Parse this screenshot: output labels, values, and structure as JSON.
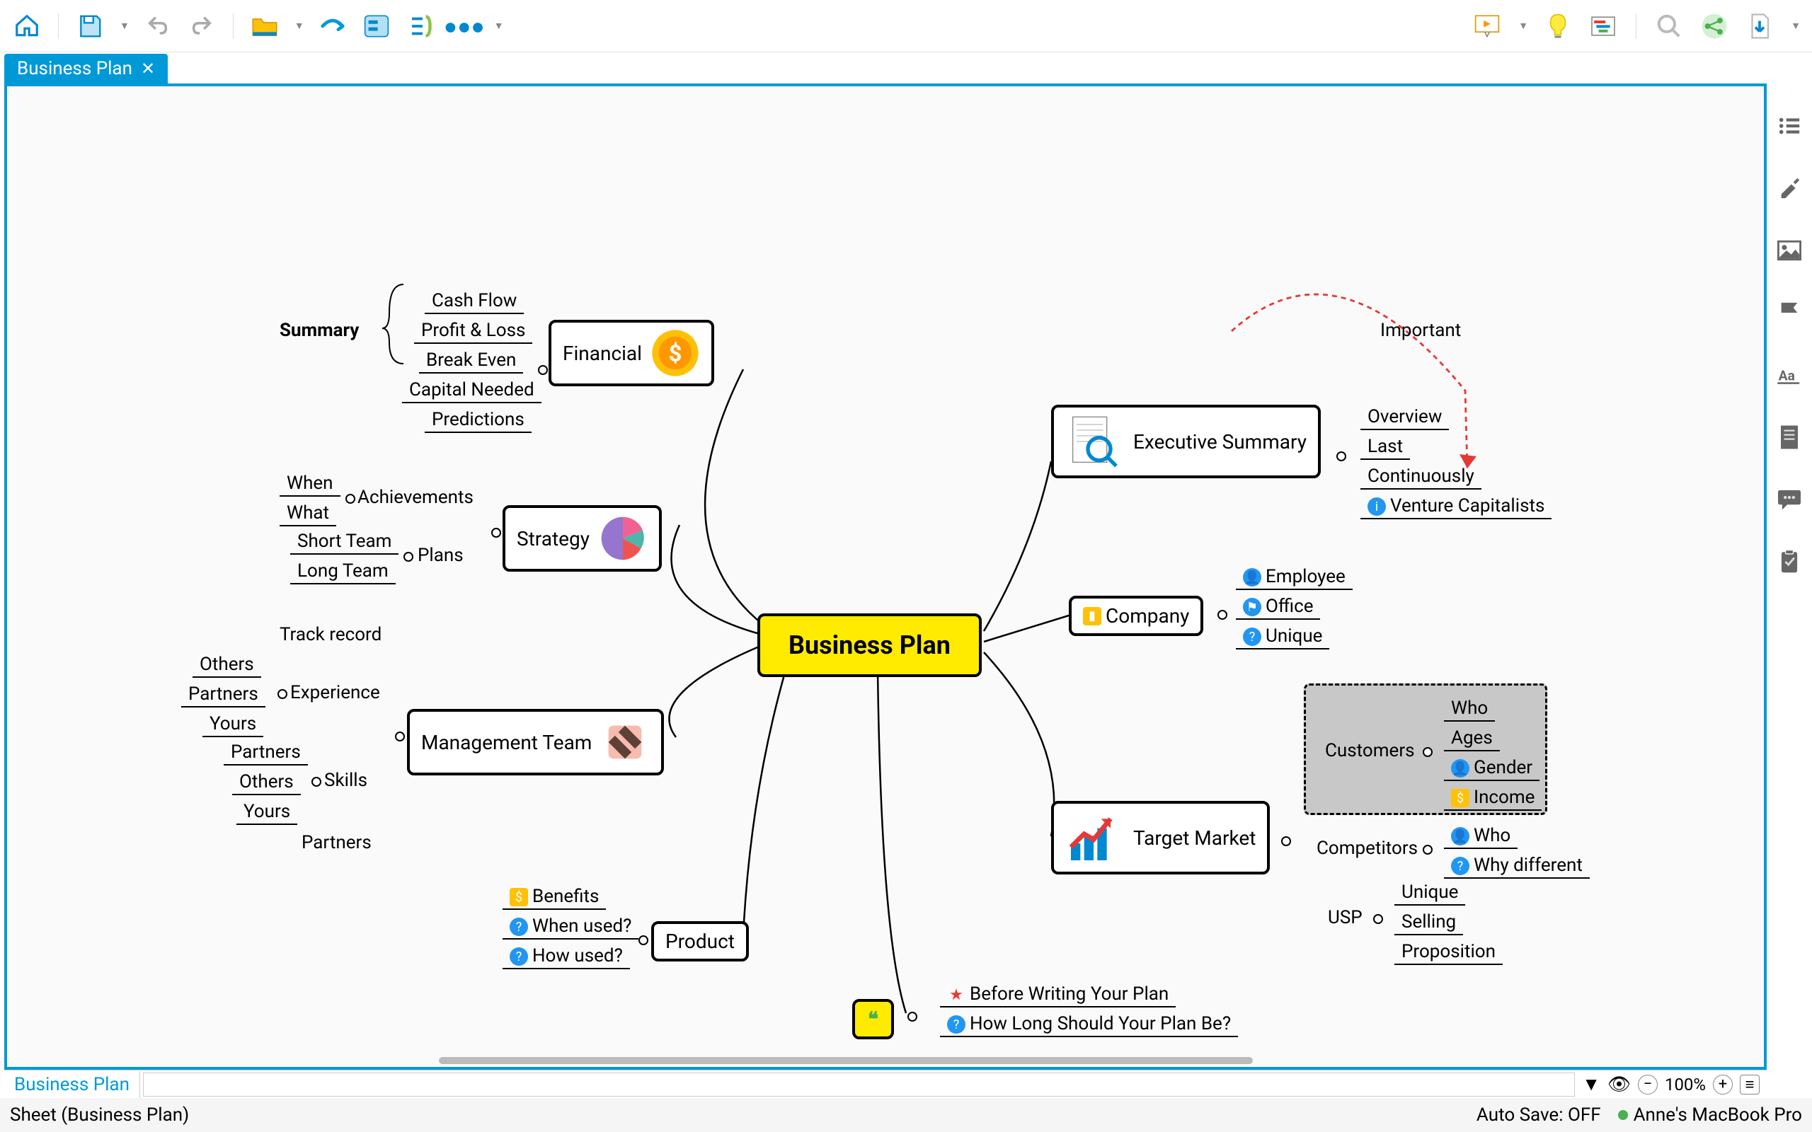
{
  "tab": {
    "title": "Business Plan"
  },
  "central": {
    "label": "Business Plan"
  },
  "financial": {
    "label": "Financial",
    "summary_label": "Summary",
    "items": [
      "Cash Flow",
      "Profit & Loss",
      "Break Even",
      "Capital Needed",
      "Predictions"
    ]
  },
  "strategy": {
    "label": "Strategy",
    "achievements": {
      "label": "Achievements",
      "items": [
        "When",
        "What"
      ]
    },
    "plans": {
      "label": "Plans",
      "items": [
        "Short Team",
        "Long Team"
      ]
    }
  },
  "management": {
    "label": "Management Team",
    "track_record": "Track record",
    "experience": {
      "label": "Experience",
      "items": [
        "Others",
        "Partners",
        "Yours"
      ]
    },
    "skills": {
      "label": "Skills",
      "items": [
        "Partners",
        "Others",
        "Yours"
      ]
    },
    "partners": "Partners"
  },
  "product": {
    "label": "Product",
    "items": [
      "Benefits",
      "When used?",
      "How used?"
    ]
  },
  "executive": {
    "label": "Executive Summary",
    "important": "Important",
    "items": [
      "Overview",
      "Last",
      "Continuously",
      "Venture Capitalists"
    ]
  },
  "company": {
    "label": "Company",
    "items": [
      "Employee",
      "Office",
      "Unique"
    ]
  },
  "target": {
    "label": "Target Market",
    "customers": {
      "label": "Customers",
      "items": [
        "Who",
        "Ages",
        "Gender",
        "Income"
      ]
    },
    "competitors": {
      "label": "Competitors",
      "items": [
        "Who",
        "Why different"
      ]
    },
    "usp": {
      "label": "USP",
      "items": [
        "Unique",
        "Selling",
        "Proposition"
      ]
    }
  },
  "notes": {
    "items": [
      "Before Writing Your Plan",
      "How Long Should Your Plan Be?"
    ]
  },
  "sheet": {
    "name": "Business Plan"
  },
  "status": {
    "sheet_label": "Sheet (Business Plan)",
    "autosave": "Auto Save: OFF",
    "device": "Anne's MacBook Pro",
    "zoom": "100%"
  }
}
